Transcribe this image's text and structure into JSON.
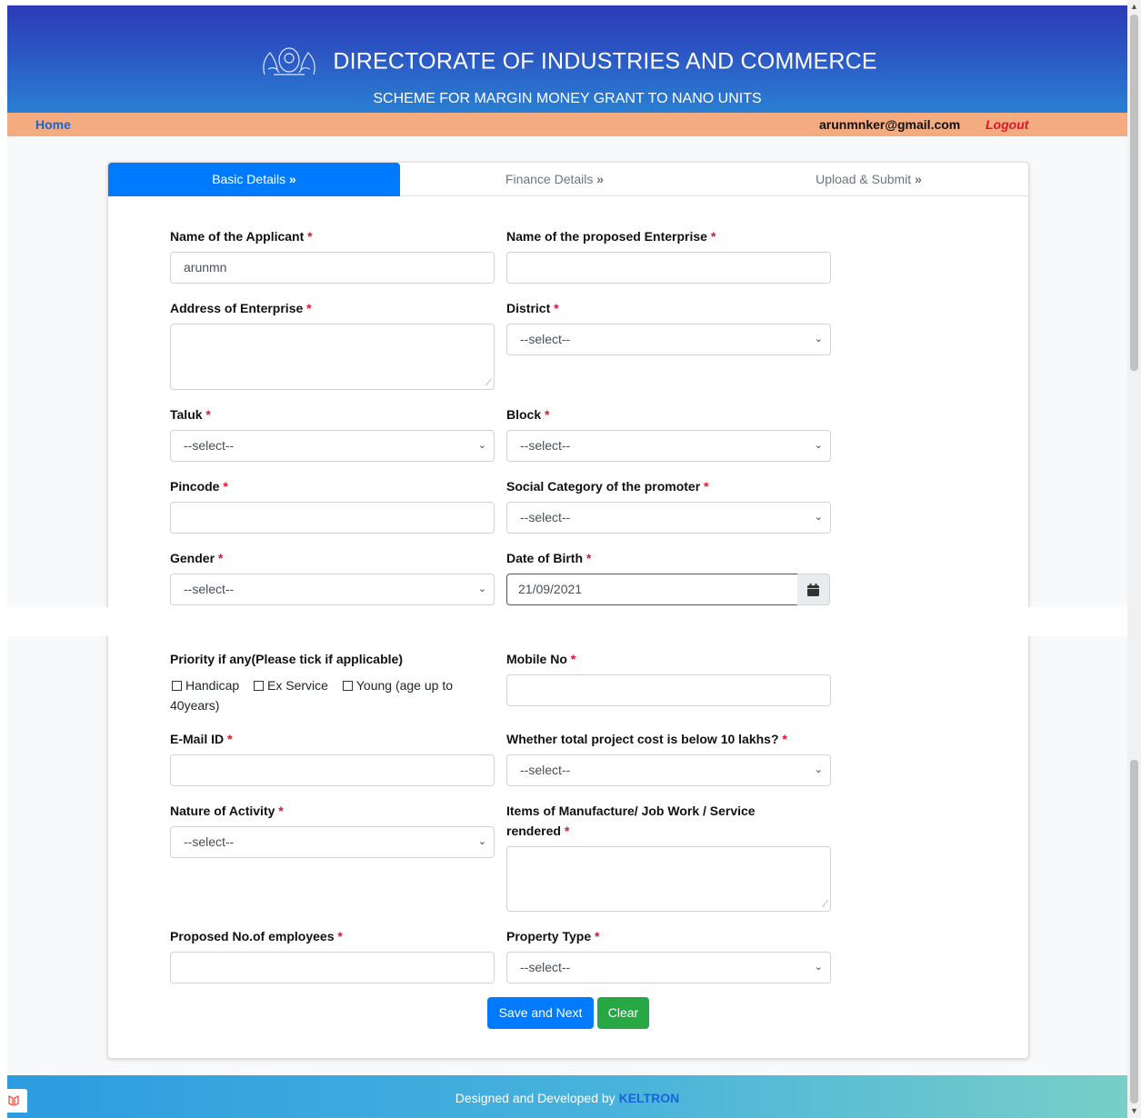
{
  "header": {
    "title": "DIRECTORATE OF INDUSTRIES AND COMMERCE",
    "subtitle": "SCHEME FOR MARGIN MONEY GRANT TO NANO UNITS"
  },
  "nav": {
    "home": "Home",
    "email": "arunmnker@gmail.com",
    "logout": "Logout"
  },
  "tabs": [
    {
      "label": "Basic Details",
      "active": true
    },
    {
      "label": "Finance Details",
      "active": false
    },
    {
      "label": "Upload & Submit",
      "active": false
    }
  ],
  "form": {
    "applicant_name": {
      "label": "Name of the Applicant",
      "value": "arunmn"
    },
    "enterprise_name": {
      "label": "Name of the proposed Enterprise",
      "value": ""
    },
    "address": {
      "label": "Address of Enterprise",
      "value": ""
    },
    "district": {
      "label": "District",
      "value": "--select--"
    },
    "taluk": {
      "label": "Taluk",
      "value": "--select--"
    },
    "block": {
      "label": "Block",
      "value": "--select--"
    },
    "pincode": {
      "label": "Pincode",
      "value": ""
    },
    "social_category": {
      "label": "Social Category of the promoter",
      "value": "--select--"
    },
    "gender": {
      "label": "Gender",
      "value": "--select--"
    },
    "dob": {
      "label": "Date of Birth",
      "value": "21/09/2021"
    },
    "priority": {
      "label": "Priority if any(Please tick if applicable)",
      "options": [
        "Handicap",
        "Ex Service",
        "Young (age up to"
      ],
      "options_wrap": "40years)"
    },
    "mobile": {
      "label": "Mobile No",
      "value": ""
    },
    "email_id": {
      "label": "E-Mail ID",
      "value": ""
    },
    "project_cost": {
      "label": "Whether total project cost is below 10 lakhs?",
      "value": "--select--"
    },
    "nature": {
      "label": "Nature of Activity",
      "value": "--select--"
    },
    "items": {
      "label_line1": "Items of Manufacture/ Job Work / Service",
      "label_line2": "rendered",
      "value": ""
    },
    "employees": {
      "label": "Proposed No.of employees",
      "value": ""
    },
    "property_type": {
      "label": "Property Type",
      "value": "--select--"
    },
    "required_mark": "*"
  },
  "buttons": {
    "save_next": "Save and Next",
    "clear": "Clear"
  },
  "footer": {
    "text": "Designed and Developed by",
    "brand": "KELTRON"
  },
  "colors": {
    "primary": "#007bff",
    "success": "#28a745",
    "nav_bar": "#f4ab7f",
    "required": "#e0142c"
  }
}
